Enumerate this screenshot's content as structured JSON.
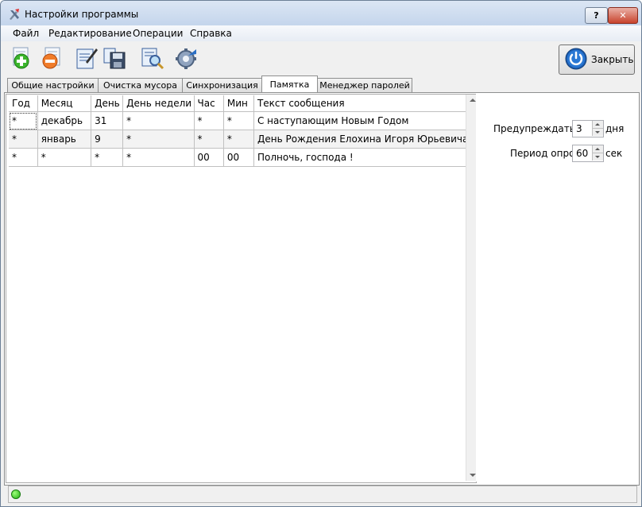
{
  "window": {
    "title": "Настройки программы",
    "help_label": "?",
    "close_label": "✕"
  },
  "menu": [
    "Файл",
    "Редактирование",
    "Операции",
    "Справка"
  ],
  "toolbar": {
    "icons": [
      "add-icon",
      "remove-icon",
      "edit-icon",
      "save-icon",
      "search-icon",
      "settings-icon"
    ],
    "close_button_label": "Закрыть"
  },
  "tabs": [
    "Общие настройки",
    "Очистка мусора",
    "Синхронизация",
    "Памятка",
    "Менеджер паролей"
  ],
  "active_tab": "Памятка",
  "grid": {
    "columns": [
      "Год",
      "Месяц",
      "День",
      "День недели",
      "Час",
      "Мин",
      "Текст сообщения"
    ],
    "rows": [
      [
        "*",
        "декабрь",
        "31",
        "*",
        "*",
        "*",
        "С наступающим Новым Годом"
      ],
      [
        "*",
        "январь",
        "9",
        "*",
        "*",
        "*",
        "День Рождения Елохина Игоря Юрьевича !"
      ],
      [
        "*",
        "*",
        "*",
        "*",
        "00",
        "00",
        "Полночь, господа !"
      ]
    ]
  },
  "settings": {
    "warn_label": "Предупреждать за",
    "warn_value": "3",
    "warn_unit": "дня",
    "poll_label": "Период опроса",
    "poll_value": "60",
    "poll_unit": "сек"
  },
  "colors": {
    "titlebar": "#c4d5ec",
    "status_led": "#1fae10",
    "close_button_icon": "#1e5fb3"
  }
}
